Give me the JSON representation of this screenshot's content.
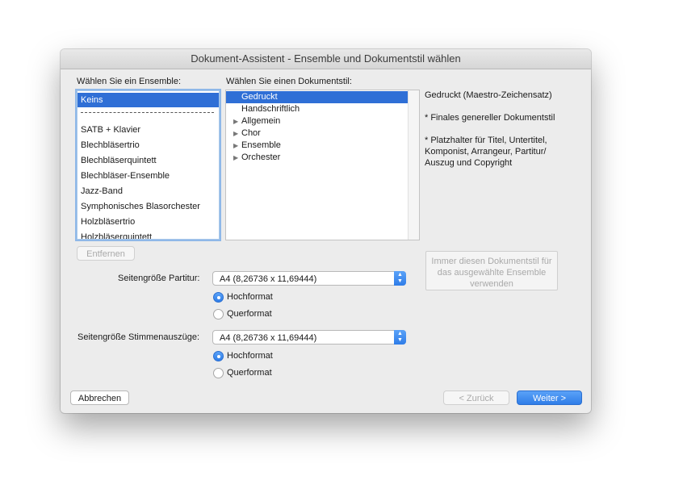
{
  "window": {
    "title": "Dokument-Assistent - Ensemble und Dokumentstil wählen"
  },
  "ensemble": {
    "label": "Wählen Sie ein Ensemble:",
    "items": [
      "Keins",
      "SATB + Klavier",
      "Blechbläsertrio",
      "Blechbläserquintett",
      "Blechbläser-Ensemble",
      "Jazz-Band",
      "Symphonisches Blasorchester",
      "Holzbläsertrio",
      "Holzbläserquintett"
    ],
    "separator": "------------------------------",
    "selected": "Keins",
    "remove_button": "Entfernen"
  },
  "style": {
    "label": "Wählen Sie einen Dokumentstil:",
    "items": [
      {
        "label": "Gedruckt",
        "expandable": false,
        "selected": true
      },
      {
        "label": "Handschriftlich",
        "expandable": false
      },
      {
        "label": "Allgemein",
        "expandable": true
      },
      {
        "label": "Chor",
        "expandable": true
      },
      {
        "label": "Ensemble",
        "expandable": true
      },
      {
        "label": "Orchester",
        "expandable": true
      }
    ]
  },
  "info": {
    "title": "Gedruckt (Maestro-Zeichensatz)",
    "line1": "* Finales genereller Dokumentstil",
    "line2": "* Platzhalter für Titel, Untertitel, Komponist, Arrangeur, Partitur/ Auszug und Copyright",
    "always_button": "Immer diesen Dokumentstil für das ausgewählte Ensemble verwenden"
  },
  "score_page": {
    "label": "Seitengröße Partitur:",
    "value": "A4 (8,26736 x 11,69444)",
    "portrait": "Hochformat",
    "landscape": "Querformat",
    "orientation": "Hochformat"
  },
  "parts_page": {
    "label": "Seitengröße Stimmenauszüge:",
    "value": "A4 (8,26736 x 11,69444)",
    "portrait": "Hochformat",
    "landscape": "Querformat",
    "orientation": "Hochformat"
  },
  "footer": {
    "cancel": "Abbrechen",
    "back": "< Zurück",
    "next": "Weiter >"
  },
  "colors": {
    "selection": "#2f6fd6",
    "accent": "#2f7de8"
  },
  "icons": {
    "expand": "disclosure-triangle-icon",
    "select": "up-down-arrows-icon"
  }
}
